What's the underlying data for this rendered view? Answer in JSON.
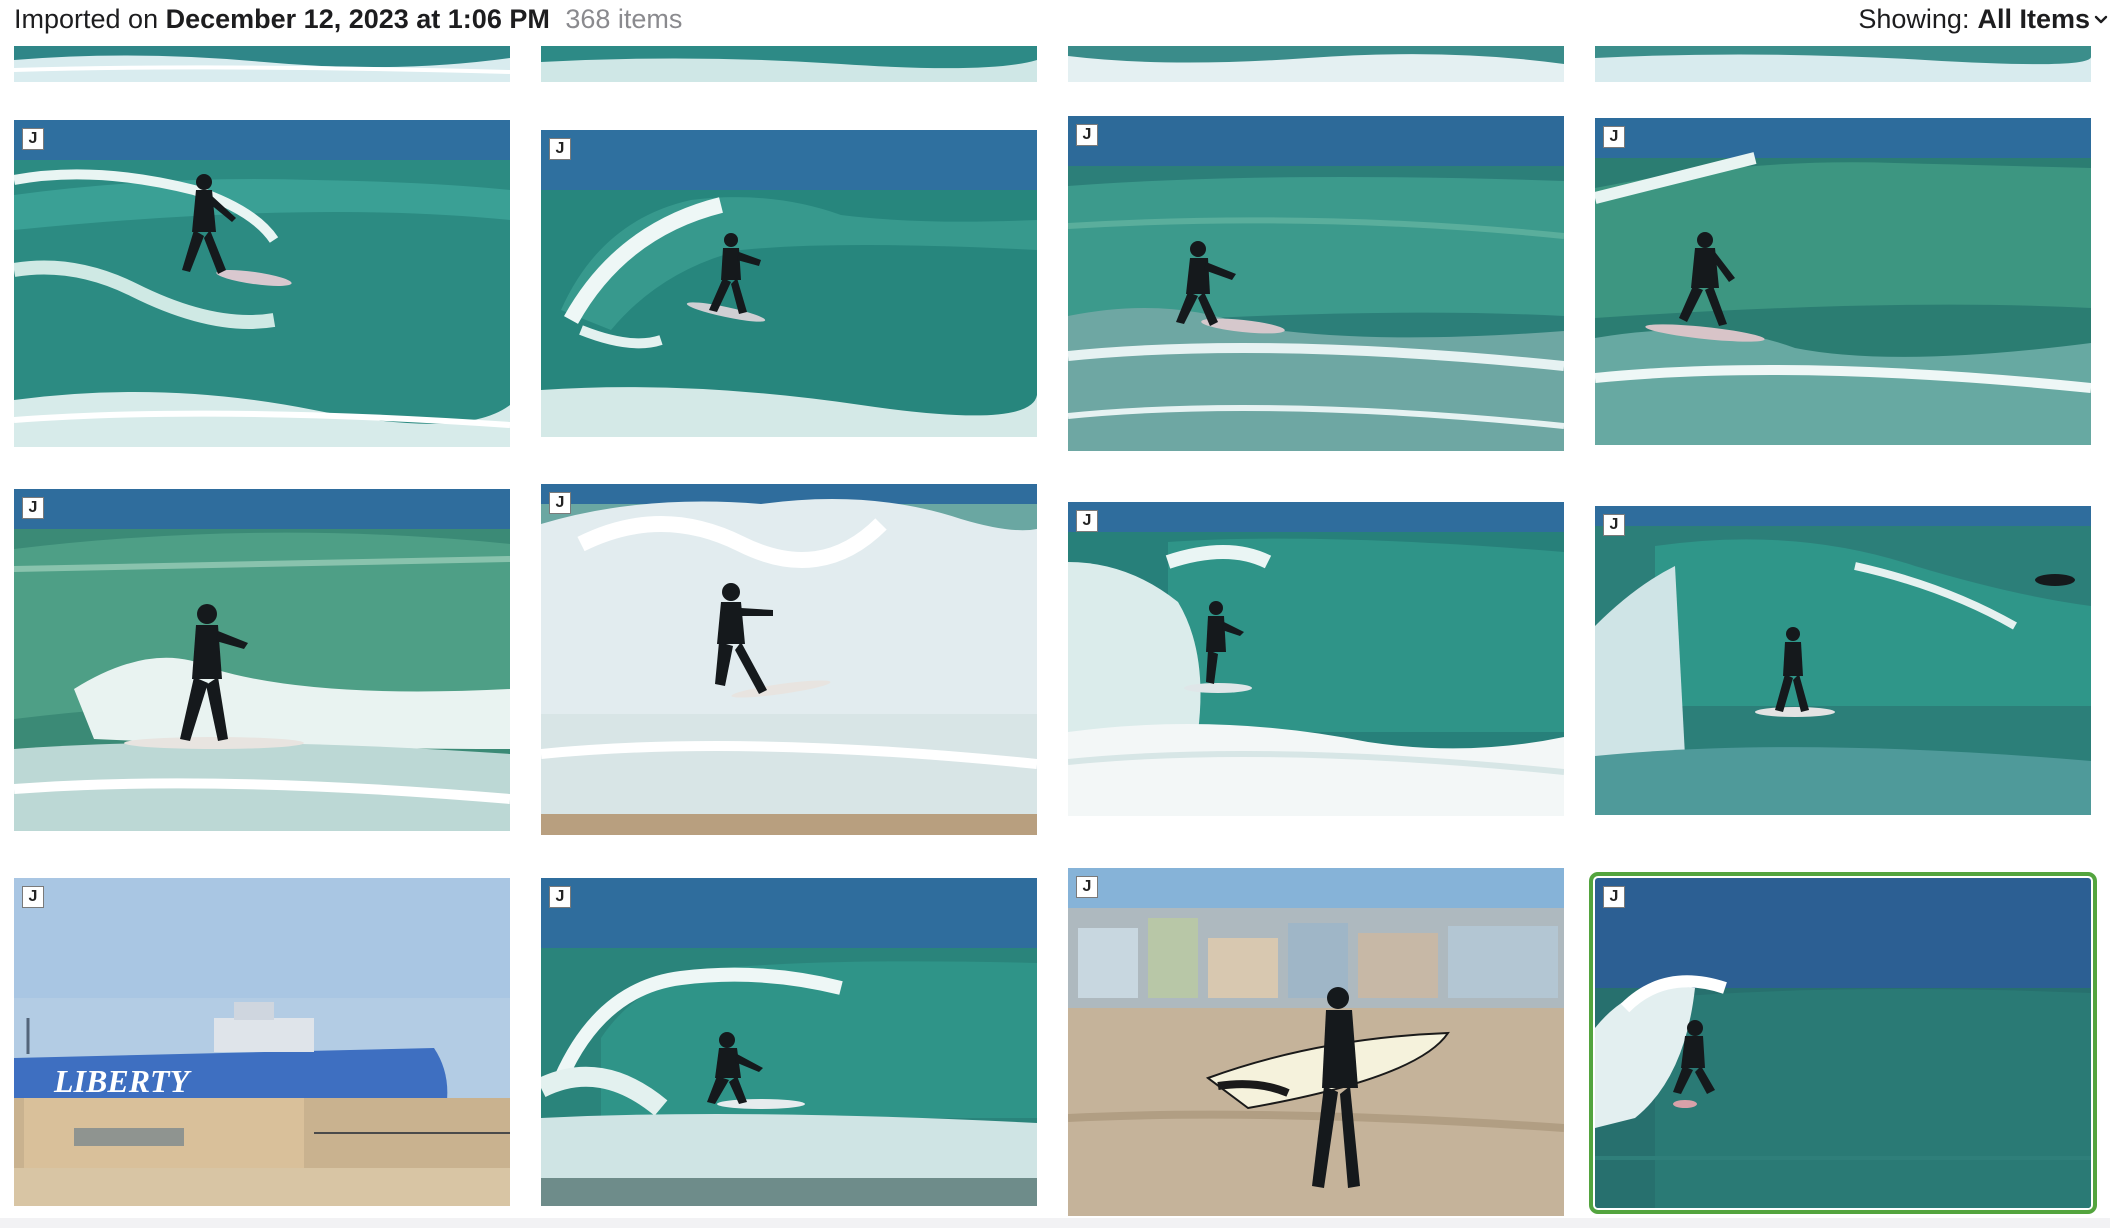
{
  "header": {
    "prefix": "Imported on",
    "date": "December 12, 2023 at 1:06 PM",
    "count": "368 items",
    "filter_label": "Showing:",
    "filter_value": "All Items"
  },
  "badge_label": "J",
  "photos": [
    {
      "id": "top-1",
      "subject": "wave-partial"
    },
    {
      "id": "top-2",
      "subject": "wave-partial"
    },
    {
      "id": "top-3",
      "subject": "wave-partial"
    },
    {
      "id": "top-4",
      "subject": "wave-partial"
    },
    {
      "id": "r1c1",
      "subject": "surfer-on-wave"
    },
    {
      "id": "r1c2",
      "subject": "surfer-on-wave"
    },
    {
      "id": "r1c3",
      "subject": "surfer-on-wave"
    },
    {
      "id": "r1c4",
      "subject": "surfer-on-wave"
    },
    {
      "id": "r2c1",
      "subject": "surfer-on-wave"
    },
    {
      "id": "r2c2",
      "subject": "surfer-in-whitewater"
    },
    {
      "id": "r2c3",
      "subject": "surfer-in-barrel"
    },
    {
      "id": "r2c4",
      "subject": "surfer-on-wave"
    },
    {
      "id": "r3c1",
      "subject": "ship-and-beach-houses",
      "ship_text": "LIBERTY"
    },
    {
      "id": "r3c2",
      "subject": "surfer-in-barrel"
    },
    {
      "id": "r3c3",
      "subject": "surfer-walking-beach"
    },
    {
      "id": "r3c4",
      "subject": "surfer-on-wave",
      "selected": true
    }
  ],
  "colors": {
    "selection": "#53a43e",
    "sea": "#2e8a86",
    "sky": "#4d86b5"
  }
}
